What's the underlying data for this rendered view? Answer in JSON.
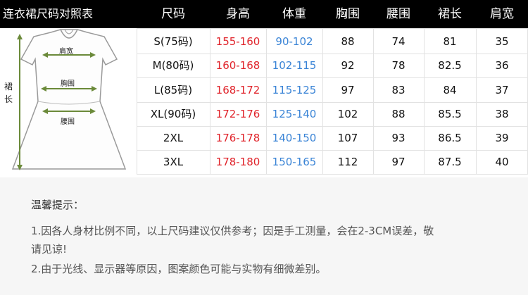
{
  "title": "连衣裙尺码对照表",
  "columns": [
    "尺码",
    "身高",
    "体重",
    "胸围",
    "腰围",
    "裙长",
    "肩宽"
  ],
  "rows": [
    {
      "size": "S(75码)",
      "height": "155-160",
      "weight": "90-102",
      "bust": "88",
      "waist": "74",
      "length": "81",
      "shoulder": "35"
    },
    {
      "size": "M(80码)",
      "height": "160-168",
      "weight": "102-115",
      "bust": "92",
      "waist": "78",
      "length": "82.5",
      "shoulder": "36"
    },
    {
      "size": "L(85码)",
      "height": "168-172",
      "weight": "115-125",
      "bust": "97",
      "waist": "83",
      "length": "84",
      "shoulder": "37"
    },
    {
      "size": "XL(90码)",
      "height": "172-176",
      "weight": "125-140",
      "bust": "102",
      "waist": "88",
      "length": "85.5",
      "shoulder": "38"
    },
    {
      "size": "2XL",
      "height": "176-178",
      "weight": "140-150",
      "bust": "107",
      "waist": "93",
      "length": "86.5",
      "shoulder": "39"
    },
    {
      "size": "3XL",
      "height": "178-180",
      "weight": "150-165",
      "bust": "112",
      "waist": "97",
      "length": "87.5",
      "shoulder": "40"
    }
  ],
  "figure_labels": {
    "shoulder": "肩宽",
    "bust": "胸围",
    "waist": "腰围",
    "length": "裙长"
  },
  "colors": {
    "height": "#e0242b",
    "weight": "#3a84d6",
    "arrow": "#6b8a3a",
    "header_bg": "#000000"
  },
  "notes": {
    "title": "温馨提示：",
    "line1": "1.因各人身材比例不同，以上尺码建议仅供参考；因是手工测量，会在2-3CM误差，敬",
    "line1b": "请见谅!",
    "line2": "2.由于光线、显示器等原因，图案颜色可能与实物有细微差别。"
  }
}
